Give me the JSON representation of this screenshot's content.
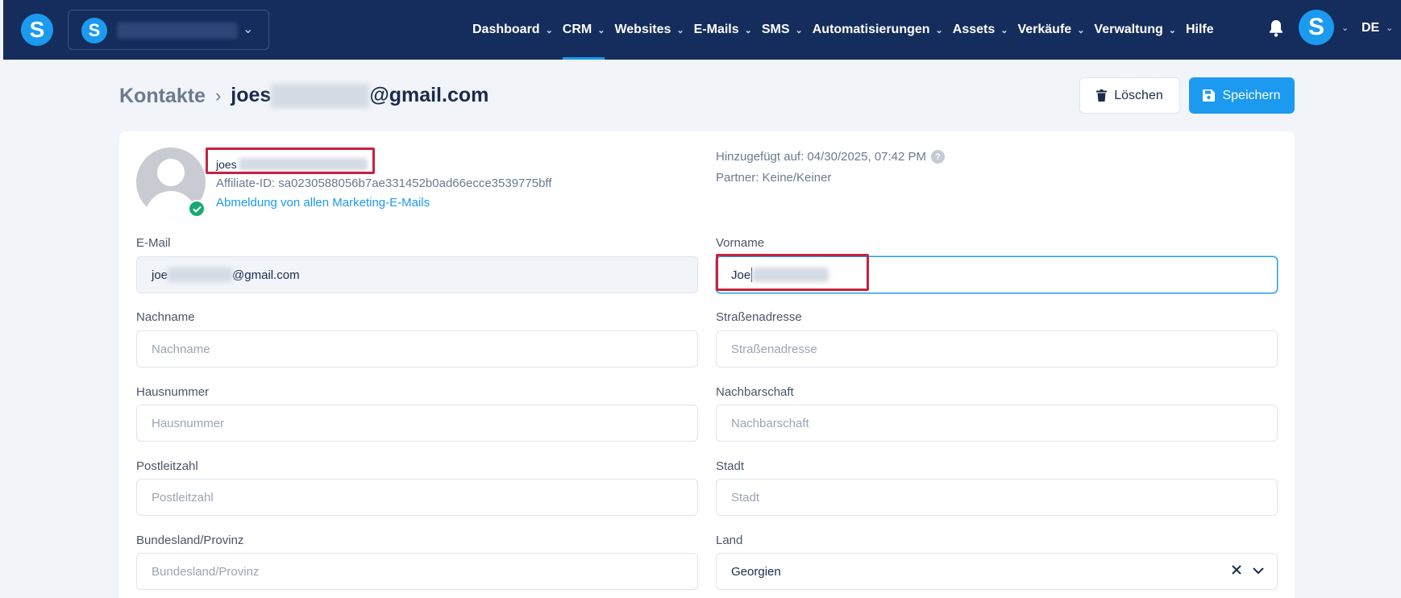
{
  "brand": {
    "logo_letter": "S"
  },
  "workspace": {
    "logo_letter": "S"
  },
  "nav": [
    {
      "label": "Dashboard",
      "dropdown": true
    },
    {
      "label": "CRM",
      "dropdown": true,
      "active": true
    },
    {
      "label": "Websites",
      "dropdown": true
    },
    {
      "label": "E-Mails",
      "dropdown": true
    },
    {
      "label": "SMS",
      "dropdown": true
    },
    {
      "label": "Automatisierungen",
      "dropdown": true
    },
    {
      "label": "Assets",
      "dropdown": true
    },
    {
      "label": "Verkäufe",
      "dropdown": true
    },
    {
      "label": "Verwaltung",
      "dropdown": true
    },
    {
      "label": "Hilfe",
      "dropdown": false
    }
  ],
  "user": {
    "avatar_letter": "S",
    "language": "DE"
  },
  "breadcrumb": {
    "parent": "Kontakte",
    "current_prefix": "joes",
    "current_suffix": "@gmail.com"
  },
  "actions": {
    "delete_label": "Löschen",
    "save_label": "Speichern"
  },
  "profile": {
    "name_prefix": "joes",
    "affiliate_id": "Affiliate-ID: sa0230588056b7ae331452b0ad66ecce3539775bff",
    "unsubscribe_link": "Abmeldung von allen Marketing-E-Mails",
    "added_on": "Hinzugefügt auf: 04/30/2025, 07:42 PM",
    "partner": "Partner: Keine/Keiner"
  },
  "form": {
    "email": {
      "label": "E-Mail",
      "value_prefix": "joe",
      "value_suffix": "@gmail.com"
    },
    "first_name": {
      "label": "Vorname",
      "value_prefix": "Joe"
    },
    "last_name": {
      "label": "Nachname",
      "placeholder": "Nachname"
    },
    "street": {
      "label": "Straßenadresse",
      "placeholder": "Straßenadresse"
    },
    "house_number": {
      "label": "Hausnummer",
      "placeholder": "Hausnummer"
    },
    "neighborhood": {
      "label": "Nachbarschaft",
      "placeholder": "Nachbarschaft"
    },
    "postal_code": {
      "label": "Postleitzahl",
      "placeholder": "Postleitzahl"
    },
    "city": {
      "label": "Stadt",
      "placeholder": "Stadt"
    },
    "state": {
      "label": "Bundesland/Provinz",
      "placeholder": "Bundesland/Provinz"
    },
    "country": {
      "label": "Land",
      "value": "Georgien"
    }
  },
  "colors": {
    "navbar": "#152d5c",
    "accent": "#1b9af0",
    "highlight": "#c8213f",
    "success": "#19a974"
  }
}
